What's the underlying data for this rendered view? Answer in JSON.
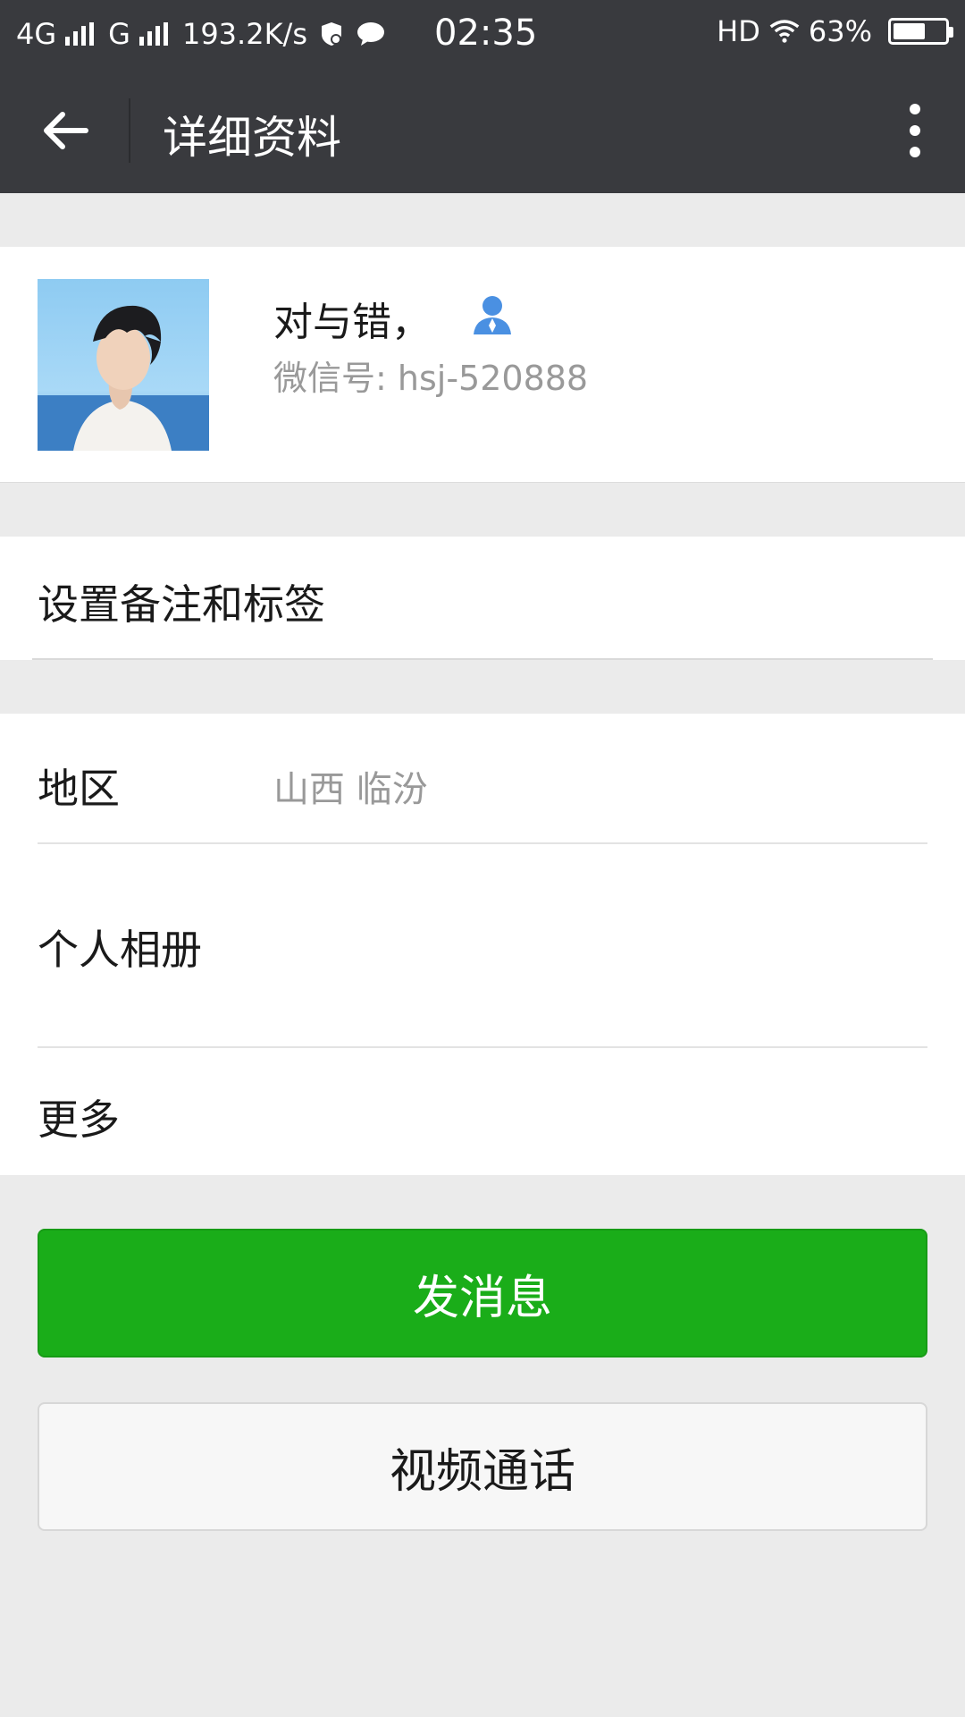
{
  "status_bar": {
    "network_1": "4G",
    "network_2": "G",
    "speed": "193.2K/s",
    "time": "02:35",
    "hd": "HD",
    "battery_percent": "63%",
    "battery_level": 0.63
  },
  "nav": {
    "title": "详细资料",
    "back_icon": "arrow-left-icon",
    "more_icon": "more-vertical-icon"
  },
  "profile": {
    "name": "对与错，",
    "wechat_id_label": "微信号: hsj-520888",
    "contact_icon": "contact-person-icon"
  },
  "remark": {
    "label": "设置备注和标签"
  },
  "info": {
    "region_label": "地区",
    "region_value": "山西  临汾",
    "album_label": "个人相册",
    "more_label": "更多"
  },
  "actions": {
    "send_message": "发消息",
    "video_call": "视频通话"
  },
  "colors": {
    "topbar": "#393a3e",
    "primary_button": "#1aad19",
    "contact_icon": "#4a90e2"
  }
}
